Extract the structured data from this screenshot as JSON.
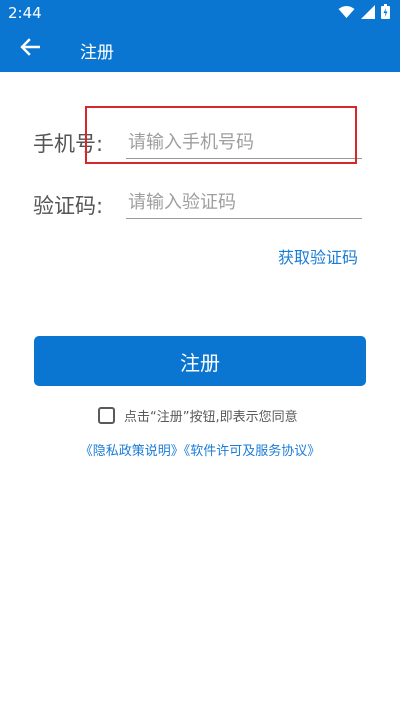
{
  "status_bar": {
    "time": "2:44",
    "icons": [
      "wifi-icon",
      "signal-icon",
      "battery-icon"
    ]
  },
  "app_bar": {
    "back_icon": "arrow-left-icon",
    "title": "注册"
  },
  "form": {
    "phone": {
      "label": "手机号:",
      "placeholder": "请输入手机号码",
      "value": ""
    },
    "code": {
      "label": "验证码:",
      "placeholder": "请输入验证码",
      "value": ""
    },
    "get_code_label": "获取验证码"
  },
  "register_button_label": "注册",
  "agreement": {
    "checked": false,
    "text": "点击“注册”按钮,即表示您同意"
  },
  "policy_links": {
    "privacy": "《隐私政策说明》",
    "license": "《软件许可及服务协议》"
  },
  "colors": {
    "primary": "#0a76d1",
    "link": "#1a7cd6",
    "highlight": "#d8262a"
  }
}
